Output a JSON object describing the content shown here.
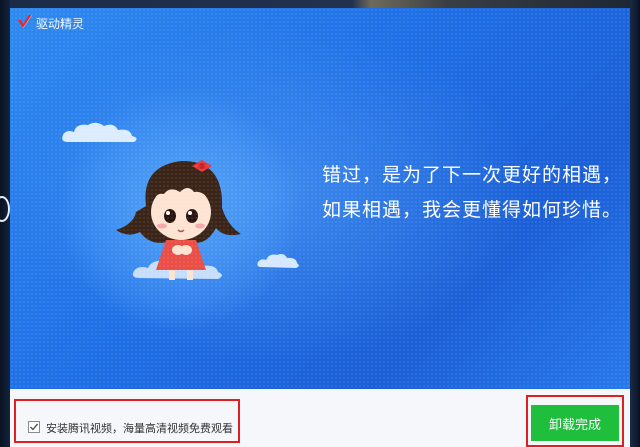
{
  "window": {
    "title": "驱动精灵"
  },
  "message": {
    "line1": "错过，是为了下一次更好的相遇，",
    "line2": "如果相遇，我会更懂得如何珍惜。"
  },
  "footer": {
    "checkbox_checked": true,
    "checkbox_label": "安装腾讯视频，海量高清视频免费观看",
    "finish_label": "卸载完成"
  },
  "colors": {
    "background_blue": "#1f6fe6",
    "button_green": "#1fbe3c",
    "highlight_red": "#e02020"
  }
}
